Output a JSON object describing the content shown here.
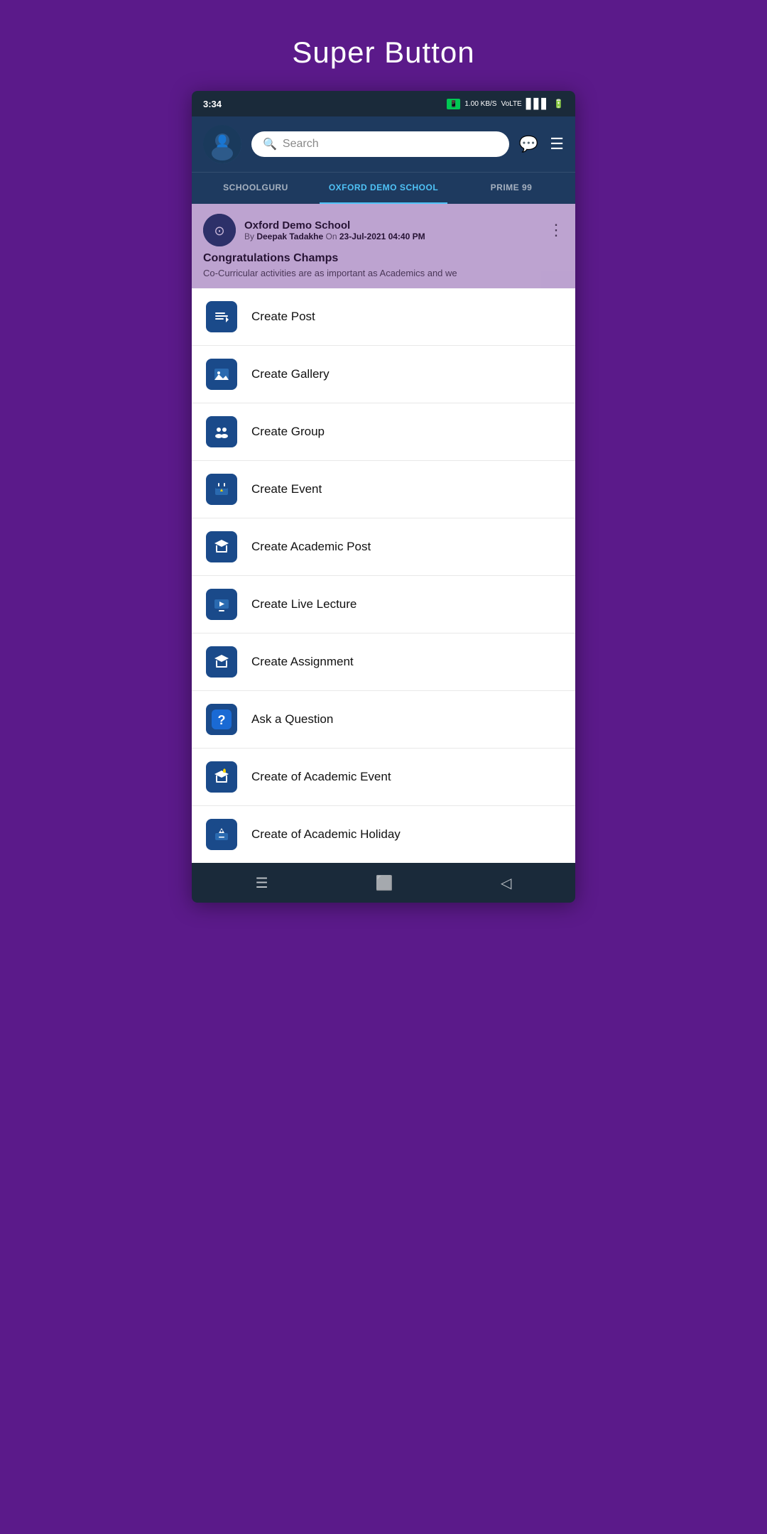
{
  "page": {
    "title": "Super Button"
  },
  "status_bar": {
    "time": "3:34",
    "network": "1.00 KB/S",
    "network_type": "VoLTE",
    "signal": "4G",
    "battery": "4"
  },
  "header": {
    "search_placeholder": "Search",
    "search_text": "Search"
  },
  "tabs": [
    {
      "label": "SCHOOLGURU",
      "active": false
    },
    {
      "label": "OXFORD DEMO SCHOOL",
      "active": true
    },
    {
      "label": "PRIME 99",
      "active": false
    }
  ],
  "post": {
    "school_name": "Oxford Demo School",
    "author": "Deepak Tadakhe",
    "date": "23-Jul-2021 04:40 PM",
    "title": "Congratulations Champs",
    "body": "Co-Curricular activities are as important as Academics and we"
  },
  "menu_items": [
    {
      "id": "create-post",
      "label": "Create Post",
      "icon": "📝"
    },
    {
      "id": "create-gallery",
      "label": "Create Gallery",
      "icon": "🖼"
    },
    {
      "id": "create-group",
      "label": "Create Group",
      "icon": "👥"
    },
    {
      "id": "create-event",
      "label": "Create Event",
      "icon": "📅"
    },
    {
      "id": "create-academic-post",
      "label": "Create Academic Post",
      "icon": "🎓"
    },
    {
      "id": "create-live-lecture",
      "label": "Create Live Lecture",
      "icon": "📺"
    },
    {
      "id": "create-assignment",
      "label": "Create Assignment",
      "icon": "🎓"
    },
    {
      "id": "ask-question",
      "label": "Ask a Question",
      "icon": "❓"
    },
    {
      "id": "create-academic-event",
      "label": "Create of Academic Event",
      "icon": "🎓"
    },
    {
      "id": "create-academic-holiday",
      "label": "Create of Academic Holiday",
      "icon": "📚"
    }
  ]
}
